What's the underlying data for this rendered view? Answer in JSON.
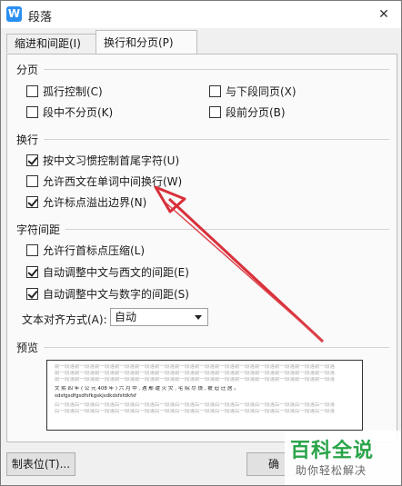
{
  "window": {
    "title": "段落",
    "icon": "wps-writer-icon",
    "close_glyph": "✕"
  },
  "tabs": [
    {
      "label": "缩进和间距(I)",
      "active": false
    },
    {
      "label": "换行和分页(P)",
      "active": true
    }
  ],
  "groups": {
    "pagination": {
      "label": "分页",
      "options": [
        {
          "label": "孤行控制(C)",
          "checked": false
        },
        {
          "label": "与下段同页(X)",
          "checked": false
        },
        {
          "label": "段中不分页(K)",
          "checked": false
        },
        {
          "label": "段前分页(B)",
          "checked": false
        }
      ]
    },
    "line_break": {
      "label": "换行",
      "options": [
        {
          "label": "按中文习惯控制首尾字符(U)",
          "checked": true
        },
        {
          "label": "允许西文在单词中间换行(W)",
          "checked": false
        },
        {
          "label": "允许标点溢出边界(N)",
          "checked": true
        }
      ]
    },
    "char_spacing": {
      "label": "字符间距",
      "options": [
        {
          "label": "允许行首标点压缩(L)",
          "checked": false
        },
        {
          "label": "自动调整中文与西文的间距(E)",
          "checked": true
        },
        {
          "label": "自动调整中文与数字的间距(S)",
          "checked": true
        }
      ],
      "align_label": "文本对齐方式(A):",
      "align_value": "自动"
    },
    "preview": {
      "label": "预览",
      "lines": [
        "前一段落前一段落前一段落前一段落前一段落前一段落前一段落前一段落前一段落前一段落前一段落前一段落前一段落前一段落",
        "前一段落前一段落前一段落前一段落前一段落前一段落前一段落前一段落前一段落前一段落前一段落前一段落前一段落前一段落",
        "前一段落前一段落前一段落前一段落前一段落前一段落前一段落前一段落前一段落前一段落前一段落前一段落前一段落前一段落",
        "文 熙 四 年 ( 公 元 408 年 ) 六 月 中 , 遇 鄢 遭 火 灾 , 宅 院 尽 烧 , 被 迫 迁 居 。",
        "sdsfgsdfgsdfsfkgskjsdkdsfsfdkfsf",
        "后一段落后一段落后一段落后一段落后一段落后一段落后一段落后一段落后一段落后一段落后一段落后一段落后一段落后一段落",
        "后一段落后一段落后一段落后一段落后一段落后一段落后一段落后一段落后一段落后一段落后一段落后一段落后一段落后一段落"
      ]
    }
  },
  "buttons": {
    "tabs": "制表位(T)...",
    "ok": "确"
  },
  "watermark": {
    "main": "百科全说",
    "sub": "助你轻松解决"
  },
  "colors": {
    "annotation_arrow": "#d8303a",
    "watermark_green": "#2aa44a"
  }
}
